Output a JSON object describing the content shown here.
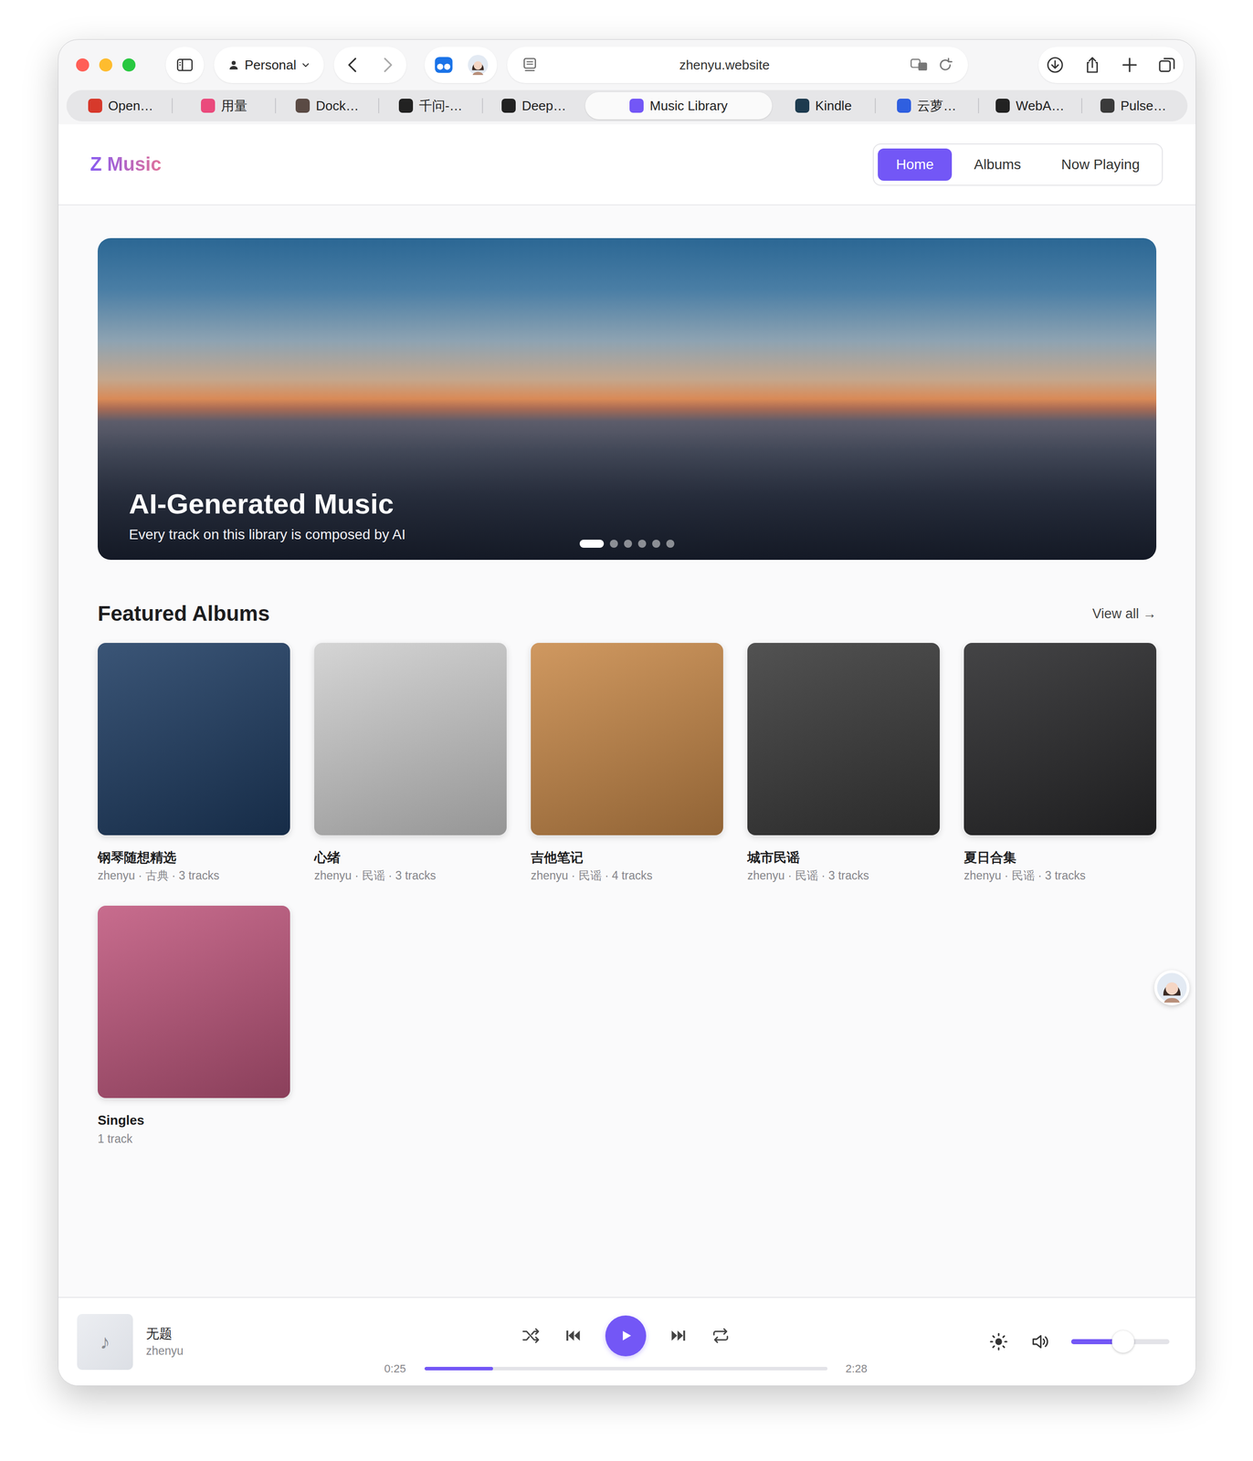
{
  "browser": {
    "profile": "Personal",
    "url": "zhenyu.website",
    "tabs": [
      {
        "label": "Open…",
        "selected": false,
        "color": "#d7392b"
      },
      {
        "label": "用量",
        "selected": false,
        "color": "#ea4a7c"
      },
      {
        "label": "Dock…",
        "selected": false,
        "color": "#5a4a44"
      },
      {
        "label": "千问-…",
        "selected": false,
        "color": "#222222"
      },
      {
        "label": "Deep…",
        "selected": false,
        "color": "#222222"
      },
      {
        "label": "Music Library",
        "selected": true,
        "color": "#7357f6"
      },
      {
        "label": "Kindle",
        "selected": false,
        "color": "#1d3b4f"
      },
      {
        "label": "云萝…",
        "selected": false,
        "color": "#2f5fe0"
      },
      {
        "label": "WebA…",
        "selected": false,
        "color": "#222222"
      },
      {
        "label": "Pulse…",
        "selected": false,
        "color": "#3a3a3a"
      }
    ]
  },
  "app": {
    "logo": "Z Music",
    "nav": [
      {
        "label": "Home",
        "selected": true
      },
      {
        "label": "Albums",
        "selected": false
      },
      {
        "label": "Now Playing",
        "selected": false
      }
    ]
  },
  "hero": {
    "title": "AI-Generated Music",
    "subtitle": "Every track on this library is composed by AI",
    "slides": [
      {
        "selected": true
      },
      {
        "selected": false
      },
      {
        "selected": false
      },
      {
        "selected": false
      },
      {
        "selected": false
      },
      {
        "selected": false
      }
    ]
  },
  "featured": {
    "heading": "Featured Albums",
    "view_all": "View all →",
    "albums": [
      {
        "title": "钢琴随想精选",
        "meta": "zhenyu · 古典 · 3 tracks",
        "color": "#1f3d63"
      },
      {
        "title": "心绪",
        "meta": "zhenyu · 民谣 · 3 tracks",
        "color": "#cfcfcf"
      },
      {
        "title": "吉他笔记",
        "meta": "zhenyu · 民谣 · 4 tracks",
        "color": "#c98a4a"
      },
      {
        "title": "城市民谣",
        "meta": "zhenyu · 民谣 · 3 tracks",
        "color": "#3a3a3a"
      },
      {
        "title": "夏日合集",
        "meta": "zhenyu · 民谣 · 3 tracks",
        "color": "#2a2a2c"
      },
      {
        "title": "Singles",
        "meta": "1 track",
        "color": "#c0587e"
      }
    ]
  },
  "player": {
    "thumb": "♪",
    "title": "无题",
    "artist": "zhenyu",
    "elapsed": "0:25",
    "duration": "2:28",
    "progress": 0.17,
    "playing": false,
    "volume": 0.53
  }
}
